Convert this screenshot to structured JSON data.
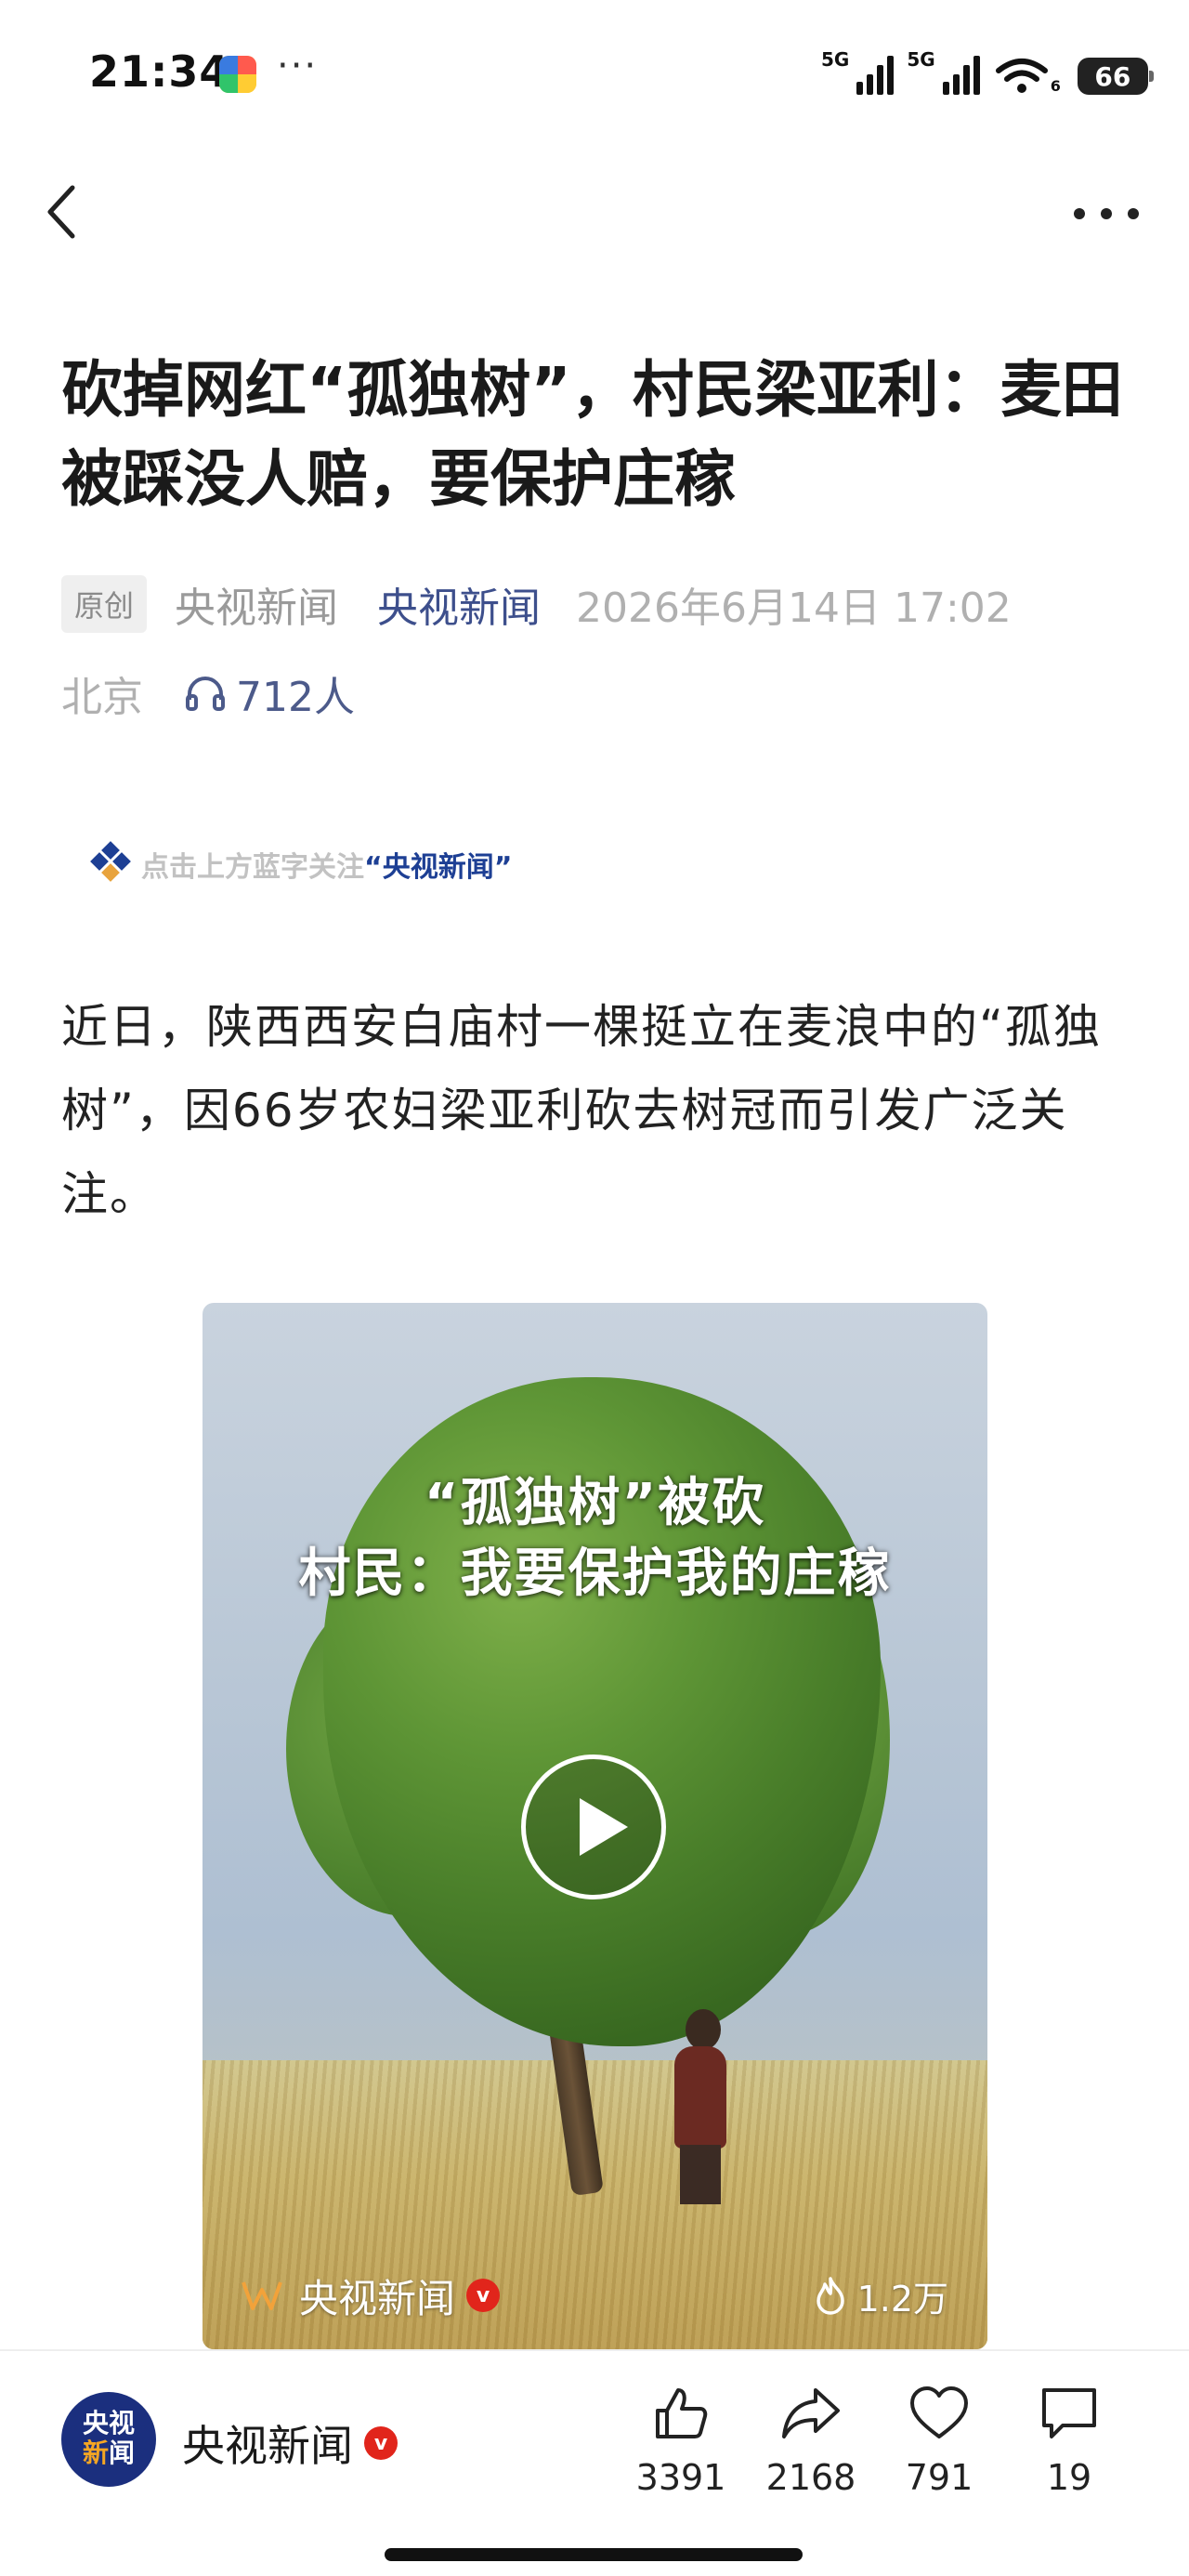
{
  "status_bar": {
    "time": "21:34",
    "more": "···",
    "signal_1_label": "5G",
    "signal_2_label": "5G",
    "wifi_label": "6",
    "battery": "66",
    "app_icon": "app-notification-icon"
  },
  "nav": {
    "back_icon": "back-arrow-icon",
    "more_icon": "more-dots-icon"
  },
  "article": {
    "title": "砍掉网红“孤独树”，村民梁亚利：麦田被踩没人赔，要保护庄稼",
    "original_badge": "原创",
    "source": "央视新闻",
    "author": "央视新闻",
    "published": "2026年6月14日 17:02",
    "location": "北京",
    "listeners": "712人",
    "follow_banner_prefix": "点击上方蓝字关注",
    "follow_banner_brand": "“央视新闻”",
    "body": "近日，陕西西安白庙村一棵挺立在麦浪中的“孤独树”，因66岁农妇梁亚利砍去树冠而引发广泛关注。"
  },
  "video": {
    "caption_line1": "“孤独树”被砍",
    "caption_line2": "村民：我要保护我的庄稼",
    "source_name": "央视新闻",
    "verified": "v",
    "views": "1.2万"
  },
  "bottom_bar": {
    "account_name": "央视新闻",
    "verified": "v",
    "avatar_line1": "央视",
    "avatar_line2a": "新",
    "avatar_line2b": "闻",
    "like_count": "3391",
    "share_count": "2168",
    "favorite_count": "791",
    "comment_count": "19"
  },
  "colors": {
    "brand_blue": "#1d3f94",
    "author_blue": "#3d4f8c",
    "verified_red": "#e1251b",
    "muted_gray": "#b0b0b0"
  }
}
